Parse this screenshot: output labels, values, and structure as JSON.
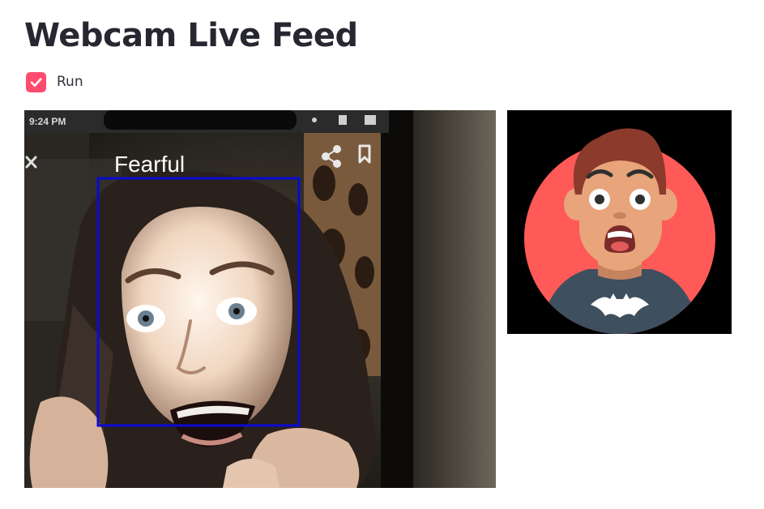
{
  "app": {
    "title": "Webcam Live Feed"
  },
  "run_control": {
    "label": "Run",
    "checked": true,
    "accent_color": "#ff4b6e"
  },
  "webcam": {
    "phone_status_time": "9:24 PM",
    "detected_emotion": "Fearful",
    "detection_box_color": "#0a0ad2",
    "icons": [
      "close-icon",
      "share-icon",
      "bookmark-icon"
    ]
  },
  "emotion_avatar": {
    "emotion": "fearful",
    "background_color": "#ff5a57"
  }
}
